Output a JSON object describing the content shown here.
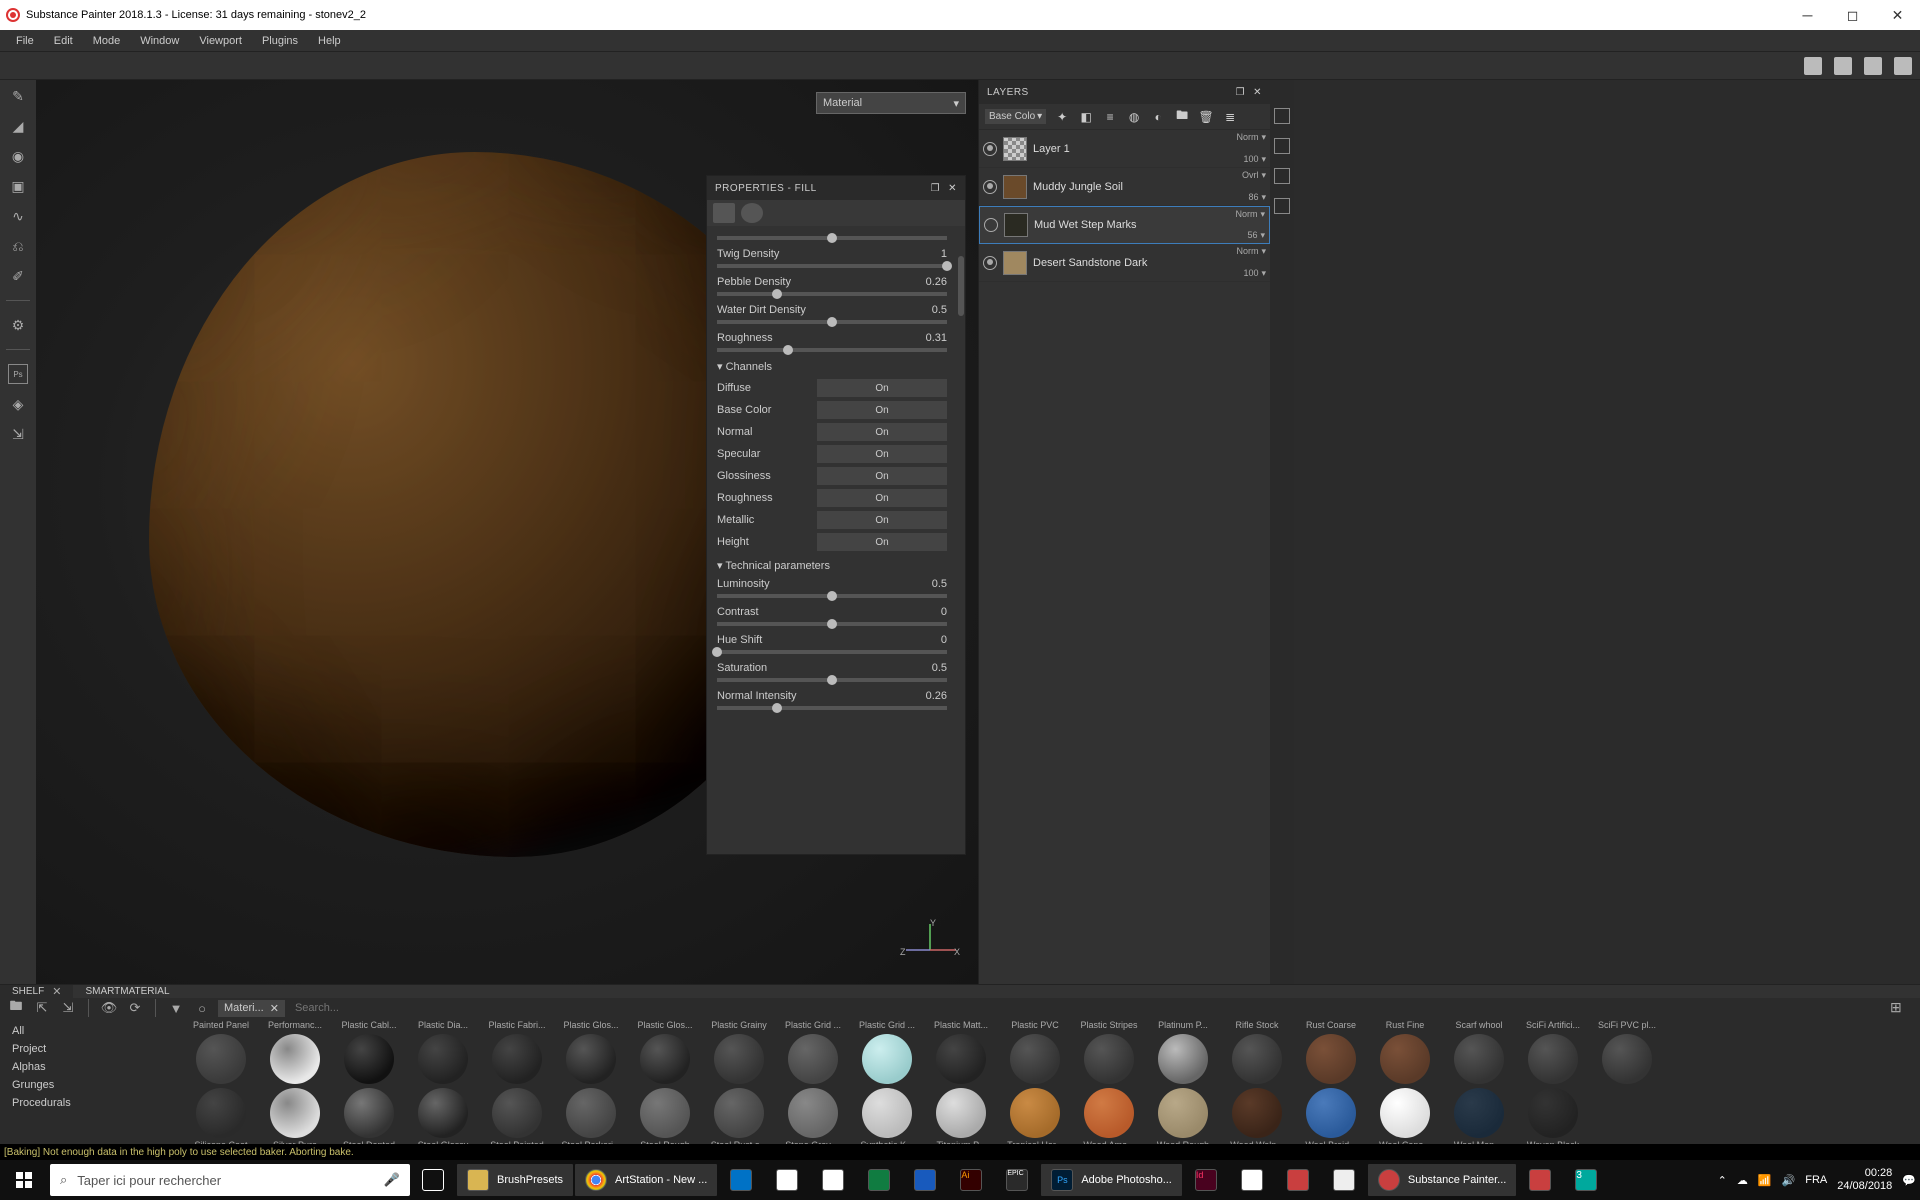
{
  "titlebar": {
    "text": "Substance Painter 2018.1.3 - License: 31 days remaining - stonev2_2"
  },
  "menubar": [
    "File",
    "Edit",
    "Mode",
    "Window",
    "Viewport",
    "Plugins",
    "Help"
  ],
  "viewport": {
    "material_dropdown": "Material",
    "axis": {
      "up": "Y",
      "right": "X",
      "left": "Z"
    }
  },
  "properties": {
    "title": "PROPERTIES - FILL",
    "sliders_top": [
      {
        "label": "",
        "value": "",
        "pct": 50
      },
      {
        "label": "Twig Density",
        "value": "1",
        "pct": 100
      },
      {
        "label": "Pebble Density",
        "value": "0.26",
        "pct": 26
      },
      {
        "label": "Water Dirt Density",
        "value": "0.5",
        "pct": 50
      },
      {
        "label": "Roughness",
        "value": "0.31",
        "pct": 31
      }
    ],
    "channels_header": "Channels",
    "channels": [
      {
        "label": "Diffuse",
        "value": "On"
      },
      {
        "label": "Base Color",
        "value": "On"
      },
      {
        "label": "Normal",
        "value": "On"
      },
      {
        "label": "Specular",
        "value": "On"
      },
      {
        "label": "Glossiness",
        "value": "On"
      },
      {
        "label": "Roughness",
        "value": "On"
      },
      {
        "label": "Metallic",
        "value": "On"
      },
      {
        "label": "Height",
        "value": "On"
      }
    ],
    "tech_header": "Technical parameters",
    "tech_sliders": [
      {
        "label": "Luminosity",
        "value": "0.5",
        "pct": 50
      },
      {
        "label": "Contrast",
        "value": "0",
        "pct": 50
      },
      {
        "label": "Hue Shift",
        "value": "0",
        "pct": 0
      },
      {
        "label": "Saturation",
        "value": "0.5",
        "pct": 50
      },
      {
        "label": "Normal Intensity",
        "value": "0.26",
        "pct": 26
      }
    ]
  },
  "layers": {
    "title": "LAYERS",
    "channel_dropdown": "Base Colo",
    "items": [
      {
        "name": "Layer 1",
        "blend": "Norm",
        "opacity": "100",
        "visible": true,
        "thumb": "checker"
      },
      {
        "name": "Muddy Jungle Soil",
        "blend": "Ovrl",
        "opacity": "86",
        "visible": true,
        "thumb": "brown"
      },
      {
        "name": "Mud Wet Step Marks",
        "blend": "Norm",
        "opacity": "56",
        "visible": false,
        "thumb": "dark",
        "selected": true
      },
      {
        "name": "Desert Sandstone Dark",
        "blend": "Norm",
        "opacity": "100",
        "visible": true,
        "thumb": "tan"
      }
    ]
  },
  "shelf": {
    "tabs": [
      {
        "label": "SHELF",
        "active": true,
        "closable": true
      },
      {
        "label": "SMARTMATERIAL",
        "active": false,
        "closable": false
      }
    ],
    "filter_chip": "Materi...",
    "search_placeholder": "Search...",
    "categories": [
      "All",
      "Project",
      "Alphas",
      "Grunges",
      "Procedurals"
    ],
    "materials_row1": [
      {
        "label": "Painted Panel",
        "c1": "#3a3a3a",
        "c2": "#555"
      },
      {
        "label": "Performanc...",
        "c1": "#e8e8e8",
        "c2": "#888"
      },
      {
        "label": "Plastic Cabl...",
        "c1": "#111",
        "c2": "#444"
      },
      {
        "label": "Plastic Dia...",
        "c1": "#222",
        "c2": "#444"
      },
      {
        "label": "Plastic Fabri...",
        "c1": "#222",
        "c2": "#444"
      },
      {
        "label": "Plastic Glos...",
        "c1": "#222",
        "c2": "#555"
      },
      {
        "label": "Plastic Glos...",
        "c1": "#222",
        "c2": "#555"
      },
      {
        "label": "Plastic Grainy",
        "c1": "#333",
        "c2": "#555"
      },
      {
        "label": "Plastic Grid ...",
        "c1": "#444",
        "c2": "#666"
      },
      {
        "label": "Plastic Grid ...",
        "c1": "#9cc",
        "c2": "#cee"
      },
      {
        "label": "Plastic Matt...",
        "c1": "#222",
        "c2": "#444"
      },
      {
        "label": "Plastic PVC",
        "c1": "#333",
        "c2": "#555"
      },
      {
        "label": "Plastic Stripes",
        "c1": "#333",
        "c2": "#555"
      },
      {
        "label": "Platinum P...",
        "c1": "#666",
        "c2": "#bbb"
      },
      {
        "label": "Rifle Stock",
        "c1": "#333",
        "c2": "#555"
      },
      {
        "label": "Rust Coarse",
        "c1": "#5a3a28",
        "c2": "#7a5038"
      },
      {
        "label": "Rust Fine",
        "c1": "#5a3a28",
        "c2": "#7a5038"
      },
      {
        "label": "Scarf whool",
        "c1": "#333",
        "c2": "#555"
      },
      {
        "label": "SciFi Artifici...",
        "c1": "#333",
        "c2": "#555"
      },
      {
        "label": "SciFi PVC pl...",
        "c1": "#333",
        "c2": "#555"
      }
    ],
    "materials_row2": [
      {
        "label": "Silicone Coat",
        "c1": "#2a2a2a",
        "c2": "#444"
      },
      {
        "label": "Silver Pure",
        "c1": "#ddd",
        "c2": "#888"
      },
      {
        "label": "Steel Dented",
        "c1": "#333",
        "c2": "#777"
      },
      {
        "label": "Steel Glossy",
        "c1": "#222",
        "c2": "#666"
      },
      {
        "label": "Steel Painted",
        "c1": "#333",
        "c2": "#555"
      },
      {
        "label": "Steel Parkeri...",
        "c1": "#444",
        "c2": "#666"
      },
      {
        "label": "Steel Rough",
        "c1": "#555",
        "c2": "#777"
      },
      {
        "label": "Steel Rust a...",
        "c1": "#444",
        "c2": "#666"
      },
      {
        "label": "Stone Grey ...",
        "c1": "#666",
        "c2": "#888"
      },
      {
        "label": "Synthetic K...",
        "c1": "#bbb",
        "c2": "#ddd"
      },
      {
        "label": "Titanium P...",
        "c1": "#aaa",
        "c2": "#ddd"
      },
      {
        "label": "Tropical Har...",
        "c1": "#a56b2a",
        "c2": "#c98a44"
      },
      {
        "label": "Wood Ame...",
        "c1": "#b85a2a",
        "c2": "#d07a44"
      },
      {
        "label": "Wood Rough",
        "c1": "#9a8a6a",
        "c2": "#b8a888"
      },
      {
        "label": "Wood Waln...",
        "c1": "#3a2418",
        "c2": "#5a3a28"
      },
      {
        "label": "Wool Braid...",
        "c1": "#2a5a9a",
        "c2": "#4a7aba"
      },
      {
        "label": "Wool Cano...",
        "c1": "#ddd",
        "c2": "#fff"
      },
      {
        "label": "Wool Men ...",
        "c1": "#1a2a3a",
        "c2": "#2a3a4a"
      },
      {
        "label": "Woven Black",
        "c1": "#222",
        "c2": "#333"
      }
    ]
  },
  "log": "[Baking] Not enough data in the high poly to use selected baker. Aborting bake.",
  "taskbar": {
    "search_placeholder": "Taper ici pour rechercher",
    "apps": [
      {
        "label": "BrushPresets",
        "color": "#d9b552"
      },
      {
        "label": "ArtStation - New ...",
        "color": "#3cba54",
        "chrome": true
      },
      {
        "label": "Adobe Photosho...",
        "color": "#001d34",
        "ps": true
      },
      {
        "label": "Substance Painter...",
        "color": "#c93f3f",
        "sp": true
      }
    ],
    "icons": [
      "outlook",
      "mail",
      "calc",
      "excel",
      "word",
      "ai",
      "epic",
      "ps",
      "id",
      "notes",
      "sketchup",
      "sticky",
      "sp2",
      "store",
      "3ds"
    ],
    "clock": {
      "time": "00:28",
      "date": "24/08/2018"
    }
  }
}
